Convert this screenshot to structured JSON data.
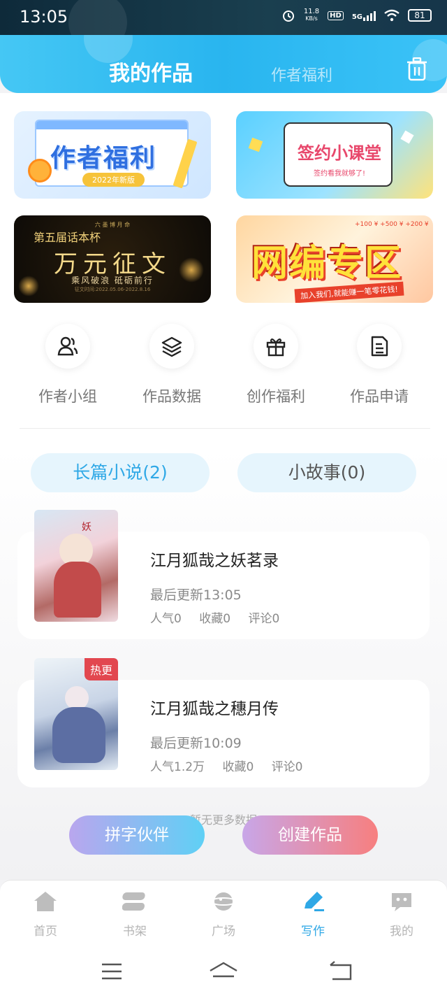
{
  "status_bar": {
    "time": "13:05",
    "net_speed_value": "11.8",
    "net_speed_unit": "KB/s",
    "hd": "HD",
    "network": "5G",
    "battery": "81"
  },
  "header": {
    "tab_active": "我的作品",
    "tab_other": "作者福利"
  },
  "banners": {
    "welfare": {
      "title": "作者福利",
      "tag": "2022年新版"
    },
    "contract": {
      "title": "签约小课堂",
      "sub": "签约看我就够了!"
    },
    "contest": {
      "top": "六 墨 博 月 命",
      "pre": "第五届话本杯",
      "title": "万元征文",
      "sub": "乘风破浪 砥砺前行",
      "date": "征文时间:2022.05.06-2022.8.16"
    },
    "editor": {
      "title": "网编专区",
      "strip": "加入我们,就能赚一笔零花钱!",
      "tags": "+100 ¥  +500 ¥  +200 ¥"
    }
  },
  "quick_links": [
    {
      "label": "作者小组",
      "icon": "users-icon"
    },
    {
      "label": "作品数据",
      "icon": "layers-icon"
    },
    {
      "label": "创作福利",
      "icon": "gift-icon"
    },
    {
      "label": "作品申请",
      "icon": "document-icon"
    }
  ],
  "segments": {
    "long": "长篇小说(2)",
    "short": "小故事(0)"
  },
  "books": [
    {
      "title": "江月狐哉之妖茗录",
      "update": "最后更新13:05",
      "popularity": "人气0",
      "collect": "收藏0",
      "comments": "评论0",
      "badge": ""
    },
    {
      "title": "江月狐哉之穗月传",
      "update": "最后更新10:09",
      "popularity": "人气1.2万",
      "collect": "收藏0",
      "comments": "评论0",
      "badge": "热更"
    }
  ],
  "no_more": "暂无更多数据",
  "actions": {
    "partner": "拼字伙伴",
    "create": "创建作品"
  },
  "tabbar": [
    {
      "label": "首页",
      "icon": "home-icon"
    },
    {
      "label": "书架",
      "icon": "bookshelf-icon"
    },
    {
      "label": "广场",
      "icon": "planet-icon"
    },
    {
      "label": "写作",
      "icon": "pen-icon",
      "active": true
    },
    {
      "label": "我的",
      "icon": "chat-face-icon"
    }
  ],
  "colors": {
    "accent": "#2fa8e6",
    "header": "#29b5ef",
    "hot": "#e2474f"
  }
}
